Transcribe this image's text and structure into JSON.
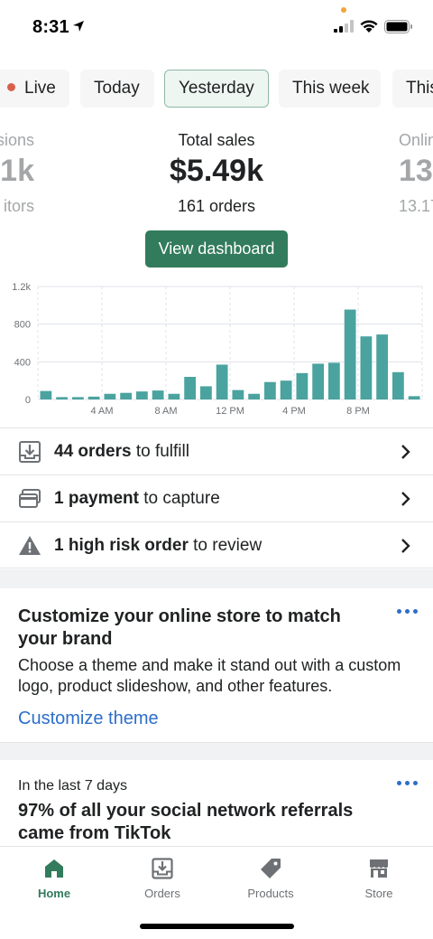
{
  "status_bar": {
    "time": "8:31"
  },
  "date_tabs": [
    {
      "label": "Live",
      "active": false
    },
    {
      "label": "Today",
      "active": false
    },
    {
      "label": "Yesterday",
      "active": true
    },
    {
      "label": "This week",
      "active": false
    },
    {
      "label": "This",
      "active": false
    }
  ],
  "metrics": {
    "left": {
      "label": "sions",
      "value": "1k",
      "sub": "itors"
    },
    "center": {
      "label": "Total sales",
      "value": "$5.49k",
      "sub": "161 orders"
    },
    "right": {
      "label": "Onlin",
      "value": "13",
      "sub": "13.17"
    }
  },
  "view_dashboard_label": "View dashboard",
  "chart_data": {
    "type": "bar",
    "x": [
      "12 AM",
      "1 AM",
      "2 AM",
      "3 AM",
      "4 AM",
      "5 AM",
      "6 AM",
      "7 AM",
      "8 AM",
      "9 AM",
      "10 AM",
      "11 AM",
      "12 PM",
      "1 PM",
      "2 PM",
      "3 PM",
      "4 PM",
      "5 PM",
      "6 PM",
      "7 PM",
      "8 PM",
      "9 PM",
      "10 PM",
      "11 PM"
    ],
    "values": [
      90,
      25,
      25,
      30,
      60,
      70,
      85,
      95,
      60,
      240,
      140,
      370,
      100,
      60,
      185,
      200,
      280,
      380,
      390,
      955,
      670,
      690,
      290,
      35
    ],
    "y_ticks": [
      "0",
      "400",
      "800",
      "1.2k"
    ],
    "ylim": [
      0,
      1200
    ],
    "x_tick_labels": [
      "4 AM",
      "8 AM",
      "12 PM",
      "4 PM",
      "8 PM"
    ],
    "color": "#4aa39f",
    "grid": true
  },
  "actions": [
    {
      "icon": "download-tray-icon",
      "bold": "44 orders",
      "rest": " to fulfill"
    },
    {
      "icon": "credit-card-icon",
      "bold": "1 payment",
      "rest": " to capture"
    },
    {
      "icon": "warning-icon",
      "bold": "1 high risk order",
      "rest": " to review"
    }
  ],
  "card_customize": {
    "title": "Customize your online store to match your brand",
    "text": "Choose a theme and make it stand out with a custom logo, product slideshow, and other features.",
    "link": "Customize theme"
  },
  "card_insight": {
    "eyebrow": "In the last 7 days",
    "title": "97% of all your social network referrals came from TikTok"
  },
  "nav": [
    {
      "label": "Home",
      "icon": "home-icon",
      "active": true
    },
    {
      "label": "Orders",
      "icon": "orders-icon",
      "active": false
    },
    {
      "label": "Products",
      "icon": "tag-icon",
      "active": false
    },
    {
      "label": "Store",
      "icon": "store-icon",
      "active": false
    }
  ],
  "colors": {
    "primary": "#327b5c",
    "link": "#2c6ecb",
    "bar": "#4aa39f"
  }
}
